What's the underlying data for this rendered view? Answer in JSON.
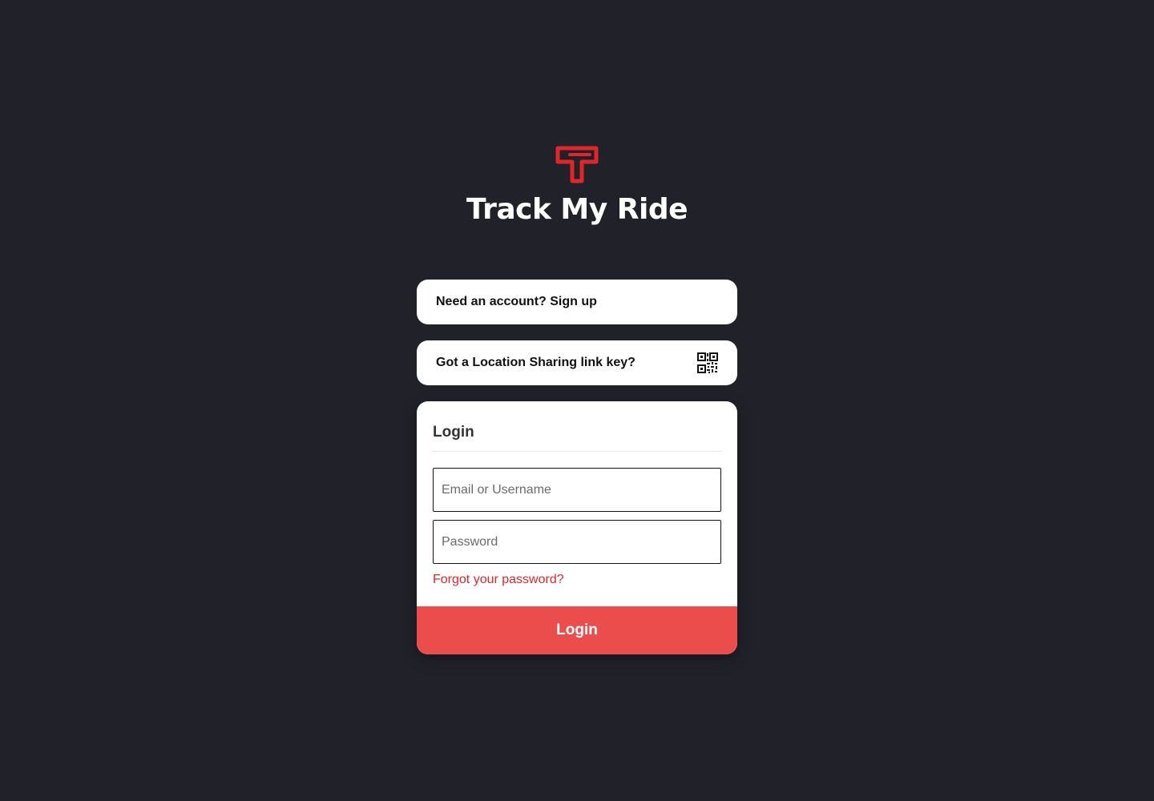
{
  "brand": {
    "name": "Track My Ride",
    "logo_icon": "track-my-ride-logo",
    "accent_color": "#e0262b"
  },
  "signup_prompt": {
    "label": "Need an account? Sign up"
  },
  "location_link": {
    "label": "Got a Location Sharing link key?",
    "icon": "qr-code-icon"
  },
  "login_form": {
    "title": "Login",
    "email_placeholder": "Email or Username",
    "email_value": "",
    "password_placeholder": "Password",
    "password_value": "",
    "forgot_label": "Forgot your password?",
    "submit_label": "Login",
    "submit_color": "#ea4d4c"
  },
  "colors": {
    "background": "#21212a",
    "card": "#ffffff"
  }
}
